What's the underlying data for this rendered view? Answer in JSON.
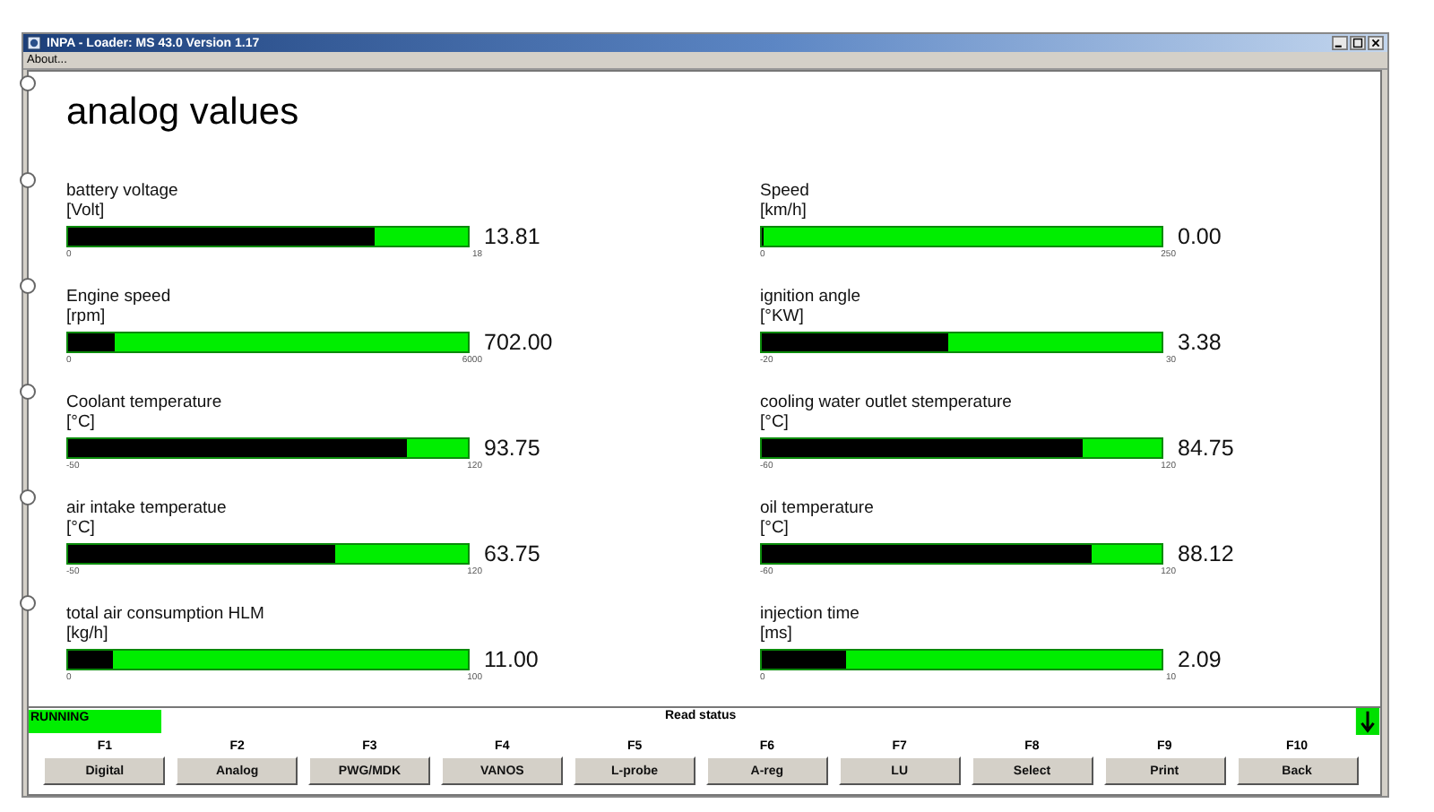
{
  "window": {
    "title": "INPA - Loader: MS 43.0 Version 1.17",
    "menu": [
      "About..."
    ]
  },
  "heading": "analog values",
  "gauges": [
    {
      "name": "battery voltage",
      "unit": "[Volt]",
      "level": 0.767,
      "value": "13.81",
      "min": "0",
      "max": "18"
    },
    {
      "name": "Speed",
      "unit": "[km/h]",
      "level": 0,
      "value": "0.00",
      "min": "0",
      "max": "250"
    },
    {
      "name": "Engine speed",
      "unit": "[rpm]",
      "level": 0.117,
      "value": "702.00",
      "min": "0",
      "max": "6000"
    },
    {
      "name": "ignition angle",
      "unit": "[°KW]",
      "level": 0.468,
      "value": "3.38",
      "min": "-20",
      "max": "30"
    },
    {
      "name": "Coolant temperature",
      "unit": "[°C]",
      "level": 0.846,
      "value": "93.75",
      "min": "-50",
      "max": "120"
    },
    {
      "name": "cooling water outlet stemperature",
      "unit": "[°C]",
      "level": 0.804,
      "value": "84.75",
      "min": "-60",
      "max": "120"
    },
    {
      "name": "air intake temperatue",
      "unit": "[°C]",
      "level": 0.669,
      "value": "63.75",
      "min": "-50",
      "max": "120"
    },
    {
      "name": "oil temperature",
      "unit": "[°C]",
      "level": 0.823,
      "value": "88.12",
      "min": "-60",
      "max": "120"
    },
    {
      "name": "total air consumption HLM",
      "unit": "[kg/h]",
      "level": 0.11,
      "value": "11.00",
      "min": "0",
      "max": "100"
    },
    {
      "name": "injection time",
      "unit": "[ms]",
      "level": 0.209,
      "value": "2.09",
      "min": "0",
      "max": "10"
    }
  ],
  "status": {
    "state": "RUNNING",
    "message": "Read status"
  },
  "function_keys": [
    {
      "key": "F1",
      "label": "Digital"
    },
    {
      "key": "F2",
      "label": "Analog"
    },
    {
      "key": "F3",
      "label": "PWG/MDK"
    },
    {
      "key": "F4",
      "label": "VANOS"
    },
    {
      "key": "F5",
      "label": "L-probe"
    },
    {
      "key": "F6",
      "label": "A-reg"
    },
    {
      "key": "F7",
      "label": "LU"
    },
    {
      "key": "F8",
      "label": "Select"
    },
    {
      "key": "F9",
      "label": "Print"
    },
    {
      "key": "F10",
      "label": "Back"
    }
  ]
}
